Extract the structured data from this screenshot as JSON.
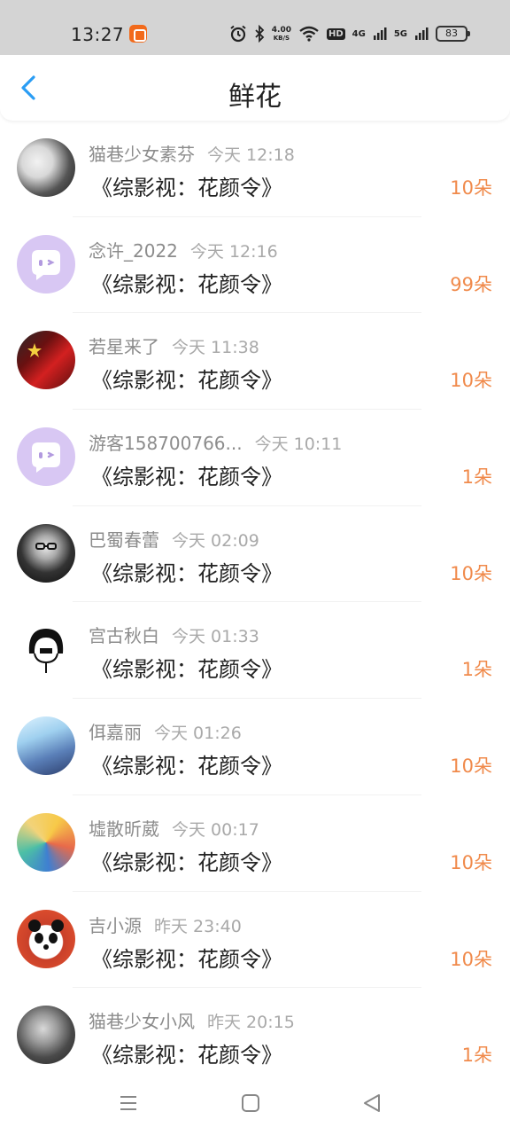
{
  "status": {
    "time": "13:27",
    "speed_value": "4.00",
    "speed_unit": "KB/S",
    "hd_badge": "HD",
    "net1": "4G",
    "net2": "5G",
    "battery": "83"
  },
  "header": {
    "title": "鲜花"
  },
  "colors": {
    "accent_blue": "#2a9df4",
    "count_orange": "#f08a4b",
    "username_gray": "#8c8c8c"
  },
  "items": [
    {
      "name": "猫巷少女素芬",
      "time": "今天 12:18",
      "book": "《综影视：花颜令》",
      "count": "10朵",
      "avatar": "dark-portrait"
    },
    {
      "name": "念许_2022",
      "time": "今天 12:16",
      "book": "《综影视：花颜令》",
      "count": "99朵",
      "avatar": "purple-chat"
    },
    {
      "name": "若星来了",
      "time": "今天 11:38",
      "book": "《综影视：花颜令》",
      "count": "10朵",
      "avatar": "red-flag"
    },
    {
      "name": "游客158700766...",
      "time": "今天 10:11",
      "book": "《综影视：花颜令》",
      "count": "1朵",
      "avatar": "purple-chat"
    },
    {
      "name": "巴蜀春蕾",
      "time": "今天 02:09",
      "book": "《综影视：花颜令》",
      "count": "10朵",
      "avatar": "glasses-portrait"
    },
    {
      "name": "宫古秋白",
      "time": "今天 01:33",
      "book": "《综影视：花颜令》",
      "count": "1朵",
      "avatar": "bob-hair-lineart"
    },
    {
      "name": "佴嘉丽",
      "time": "今天 01:26",
      "book": "《综影视：花颜令》",
      "count": "10朵",
      "avatar": "anime-blue"
    },
    {
      "name": "墟散昕葳",
      "time": "今天 00:17",
      "book": "《综影视：花颜令》",
      "count": "10朵",
      "avatar": "anime-colorful"
    },
    {
      "name": "吉小源",
      "time": "昨天 23:40",
      "book": "《综影视：花颜令》",
      "count": "10朵",
      "avatar": "panda-red"
    },
    {
      "name": "猫巷少女小风",
      "time": "昨天 20:15",
      "book": "《综影视：花颜令》",
      "count": "1朵",
      "avatar": "mirror-selfie"
    }
  ]
}
